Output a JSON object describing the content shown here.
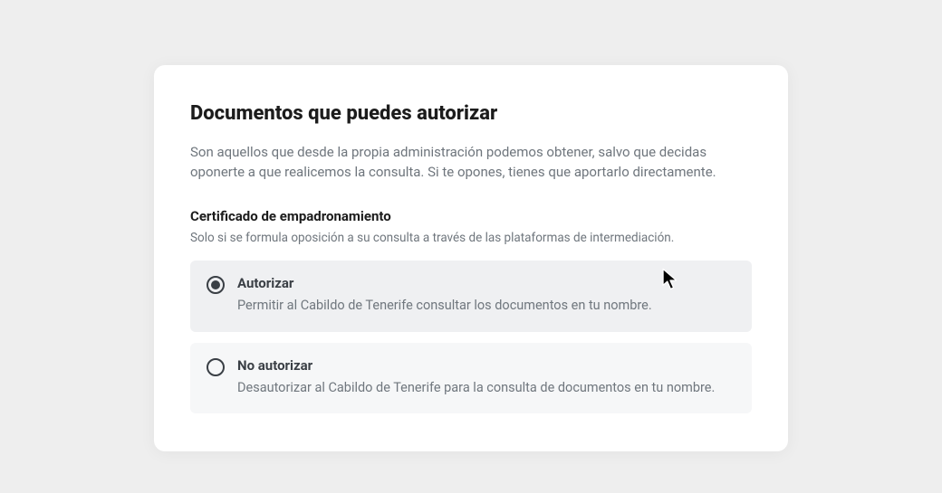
{
  "card": {
    "title": "Documentos que puedes autorizar",
    "description": "Son aquellos que desde la propia administración podemos obtener, salvo que decidas oponerte a que realicemos la consulta. Si te opones, tienes que aportarlo directamente."
  },
  "section": {
    "title": "Certificado de empadronamiento",
    "note": "Solo si se formula oposición a su consulta a través de las plataformas de intermediación."
  },
  "options": {
    "authorize": {
      "label": "Autorizar",
      "description": "Permitir al Cabildo de Tenerife consultar los documentos en tu nombre."
    },
    "deny": {
      "label": "No autorizar",
      "description": "Desautorizar al Cabildo de Tenerife para la consulta de documentos en tu nombre."
    }
  }
}
